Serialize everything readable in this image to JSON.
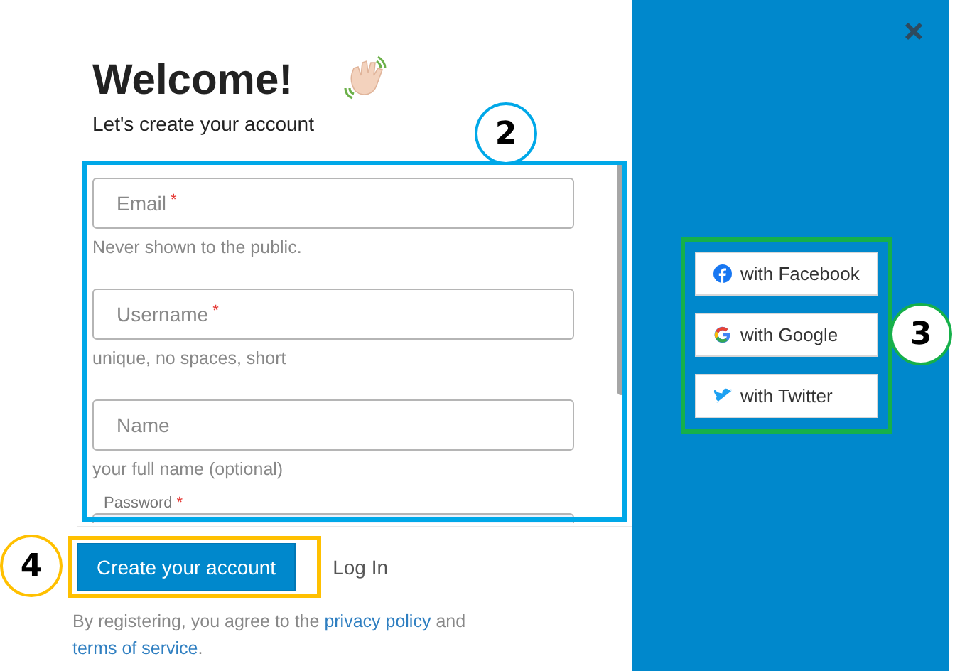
{
  "header": {
    "title": "Welcome!",
    "subtitle": "Let's create your account"
  },
  "fields": [
    {
      "kind": "plain",
      "label": "Email",
      "required_mark": "*",
      "hint": "Never shown to the public."
    },
    {
      "kind": "plain",
      "label": "Username",
      "required_mark": "*",
      "hint": "unique, no spaces, short"
    },
    {
      "kind": "plain",
      "label": "Name",
      "hint": "your full name (optional)"
    },
    {
      "kind": "floating",
      "label": "Password",
      "required_mark": "*"
    }
  ],
  "primary_button": "Create your account",
  "secondary_link": "Log In",
  "agreement": {
    "before": "By registering, you agree to the",
    "link1": "privacy policy",
    "middle": "and",
    "link2": "terms of service",
    "after": "."
  },
  "social": [
    {
      "kind": "facebook",
      "label": "with Facebook"
    },
    {
      "kind": "google",
      "label": "with Google"
    },
    {
      "kind": "twitter",
      "label": "with Twitter"
    }
  ],
  "annotations": [
    {
      "kind": "form",
      "number": "2",
      "color": "#00a8e8"
    },
    {
      "kind": "social",
      "number": "3",
      "color": "#16b04a"
    },
    {
      "kind": "button",
      "number": "4",
      "color": "#ffc000"
    }
  ]
}
